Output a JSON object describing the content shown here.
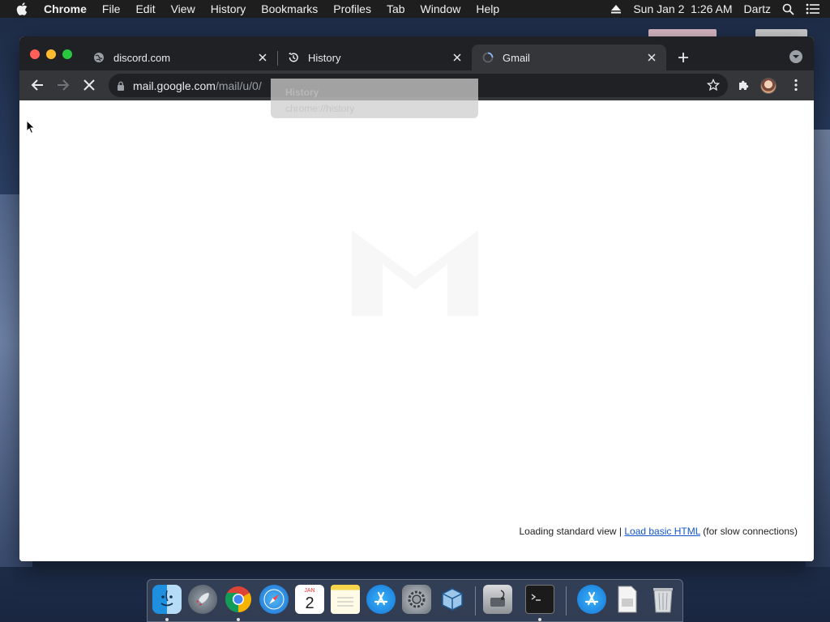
{
  "menubar": {
    "app": "Chrome",
    "items": [
      "File",
      "Edit",
      "View",
      "History",
      "Bookmarks",
      "Profiles",
      "Tab",
      "Window",
      "Help"
    ],
    "clock": "Sun Jan 2  1:26 AM",
    "user": "Dartz"
  },
  "tabs": [
    {
      "title": "discord.com",
      "icon": "globe-icon"
    },
    {
      "title": "History",
      "icon": "history-icon"
    },
    {
      "title": "Gmail",
      "icon": "loading-spinner-icon",
      "active": true
    }
  ],
  "omnibox": {
    "host": "mail.google.com",
    "path": "/mail/u/0/"
  },
  "dropdown": {
    "title": "History",
    "url": "chrome://history"
  },
  "page": {
    "loading_prefix": "Loading standard view | ",
    "link": "Load basic HTML",
    "loading_suffix": " (for slow connections)"
  },
  "dock": {
    "calendar_month": "JAN",
    "calendar_day": "2",
    "apps": [
      "Finder",
      "Launchpad",
      "Google Chrome",
      "Safari",
      "Calendar",
      "Notes",
      "App Store",
      "System Preferences",
      "VirtualBox",
      "Disk Utility",
      "Terminal",
      "App Store Downloads",
      "Document",
      "Trash"
    ]
  },
  "colors": {
    "tabstrip": "#202124",
    "toolbar": "#35363a",
    "link": "#1155cc"
  }
}
